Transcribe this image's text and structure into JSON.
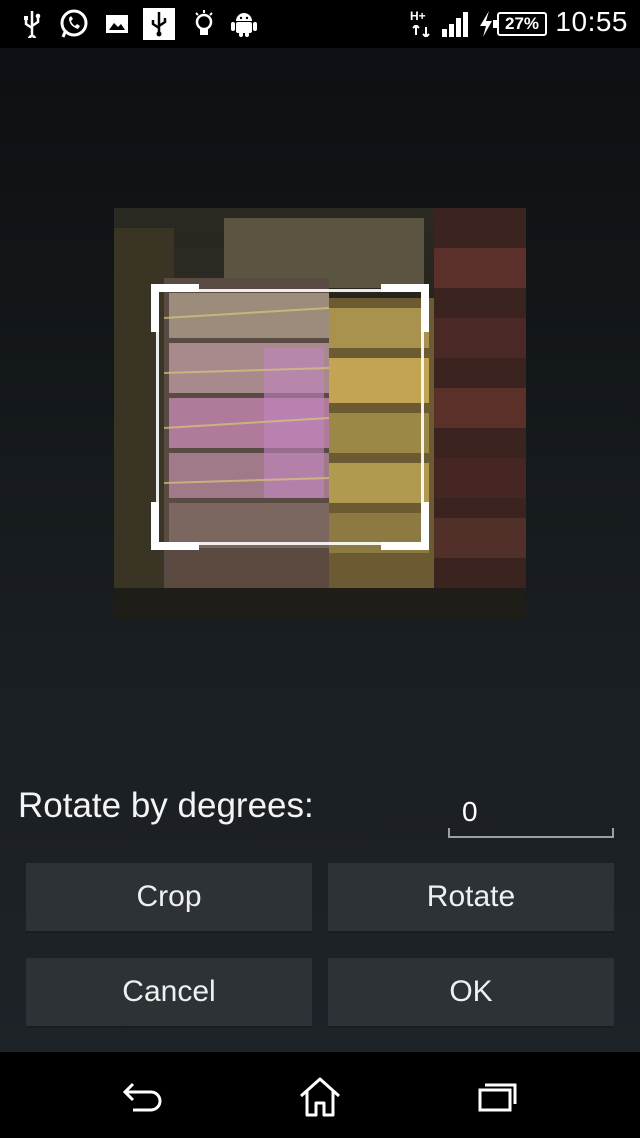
{
  "status_bar": {
    "left_icons": [
      "usb-icon",
      "whatsapp-icon",
      "gallery-icon",
      "usb-debug-icon",
      "lightbulb-icon",
      "android-icon"
    ],
    "network_label": "H+",
    "battery": "27%",
    "time": "10:55"
  },
  "editor": {
    "rotate_label": "Rotate by degrees:",
    "degrees_value": "0",
    "buttons": {
      "crop": "Crop",
      "rotate": "Rotate",
      "cancel": "Cancel",
      "ok": "OK"
    }
  },
  "nav": {
    "icons": [
      "back-icon",
      "home-icon",
      "recents-icon"
    ]
  }
}
